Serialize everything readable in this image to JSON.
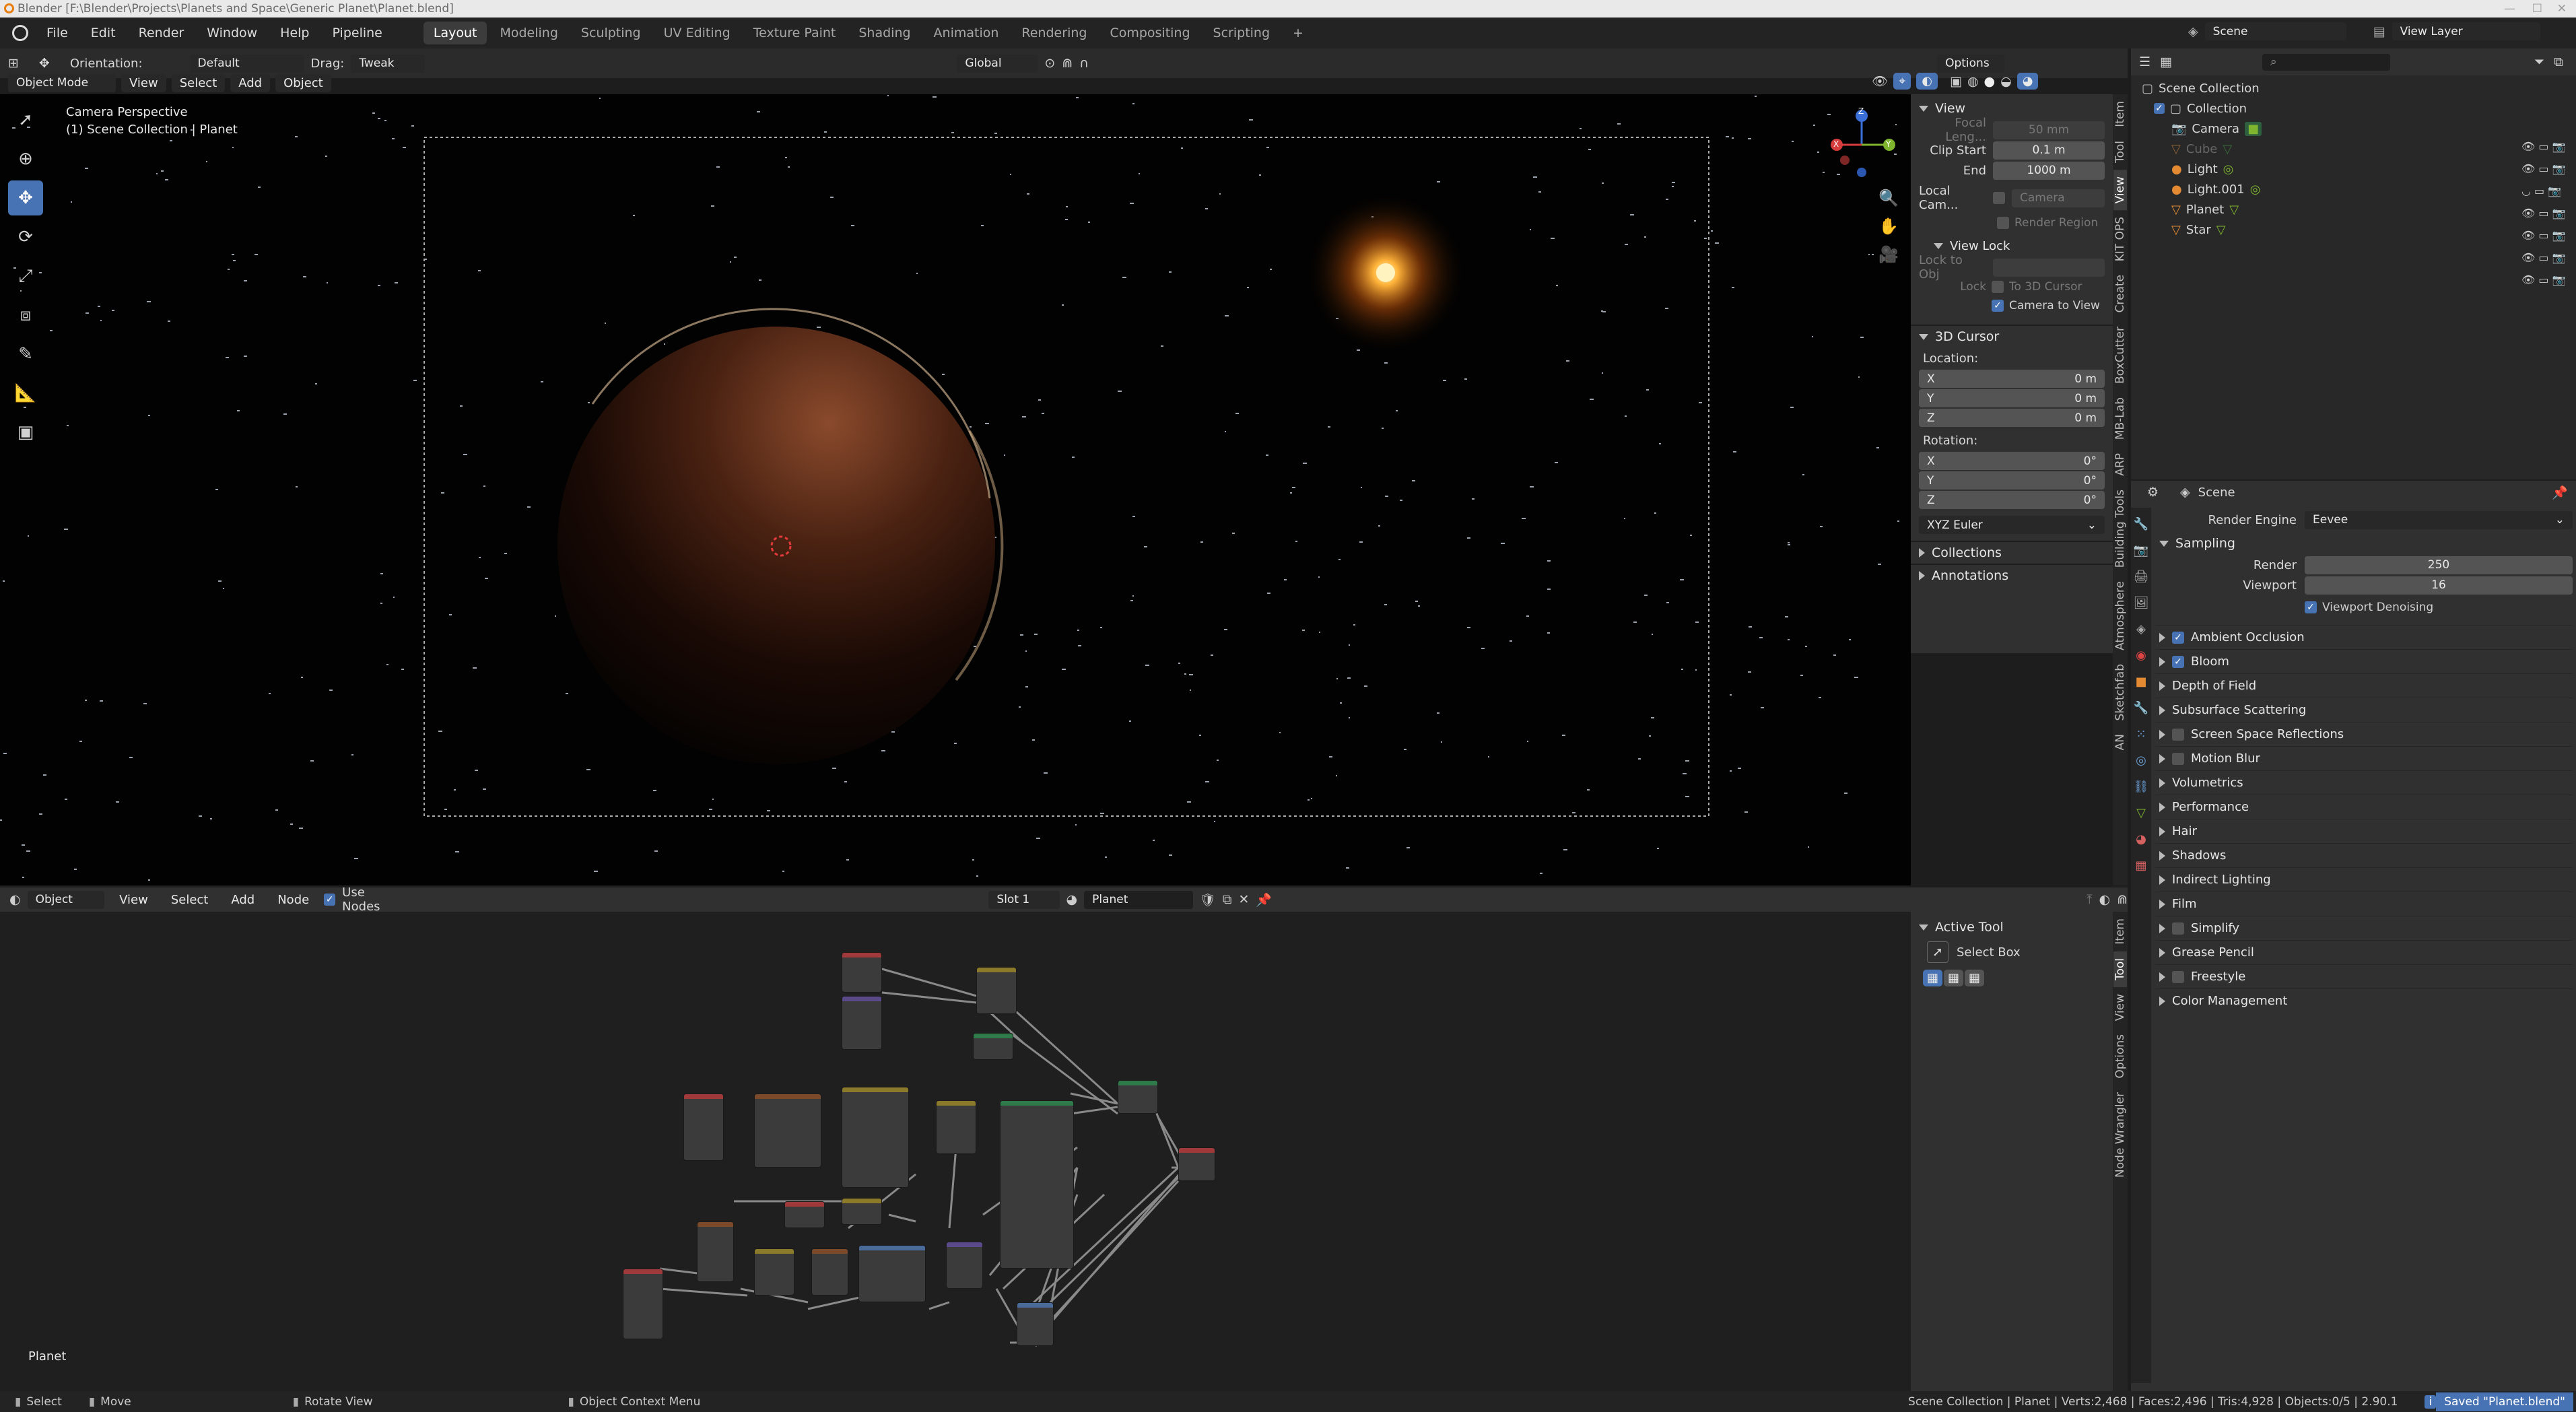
{
  "titlebar": {
    "text": "Blender [F:\\Blender\\Projects\\Planets and Space\\Generic Planet\\Planet.blend]"
  },
  "menus": [
    "File",
    "Edit",
    "Render",
    "Window",
    "Help",
    "Pipeline"
  ],
  "workspaces": [
    "Layout",
    "Modeling",
    "Sculpting",
    "UV Editing",
    "Texture Paint",
    "Shading",
    "Animation",
    "Rendering",
    "Compositing",
    "Scripting"
  ],
  "active_workspace": "Layout",
  "scene": {
    "label": "Scene",
    "view_layer": "View Layer"
  },
  "tool_settings": {
    "orientation_label": "Orientation:",
    "orientation_value": "Default",
    "drag_label": "Drag:",
    "drag_value": "Tweak",
    "transform_value": "Global",
    "options_label": "Options"
  },
  "viewport": {
    "mode": "Object Mode",
    "menus": [
      "View",
      "Select",
      "Add",
      "Object"
    ],
    "camera_label": "Camera Perspective",
    "collection_label": "(1) Scene Collection | Planet",
    "gizmo": {
      "x": "X",
      "y": "Y",
      "z": "Z"
    }
  },
  "npanel": {
    "view": {
      "title": "View",
      "focal_label": "Focal Leng...",
      "focal_value": "50 mm",
      "clip_start_label": "Clip Start",
      "clip_start_value": "0.1 m",
      "end_label": "End",
      "end_value": "1000 m",
      "local_cam_label": "Local Cam...",
      "local_cam_value": "Camera",
      "render_region": "Render Region",
      "view_lock": "View Lock",
      "lock_to_obj": "Lock to Obj",
      "lock_label": "Lock",
      "to_3d_cursor": "To 3D Cursor",
      "camera_to_view": "Camera to View"
    },
    "cursor": {
      "title": "3D Cursor",
      "location_label": "Location:",
      "loc": [
        {
          "axis": "X",
          "value": "0 m"
        },
        {
          "axis": "Y",
          "value": "0 m"
        },
        {
          "axis": "Z",
          "value": "0 m"
        }
      ],
      "rotation_label": "Rotation:",
      "rot": [
        {
          "axis": "X",
          "value": "0°"
        },
        {
          "axis": "Y",
          "value": "0°"
        },
        {
          "axis": "Z",
          "value": "0°"
        }
      ],
      "euler": "XYZ Euler"
    },
    "collections": "Collections",
    "annotations": "Annotations",
    "tabs": [
      "Item",
      "Tool",
      "View",
      "KIT OPS",
      "Create",
      "BoxCutter",
      "MB-Lab",
      "ARP",
      "Building Tools",
      "Atmosphere",
      "Sketchfab",
      "AN"
    ]
  },
  "outliner": {
    "root": "Scene Collection",
    "collection": "Collection",
    "items": [
      "Camera",
      "Cube",
      "Light",
      "Light.001",
      "Planet",
      "Star"
    ]
  },
  "properties": {
    "scene_label": "Scene",
    "render_engine_label": "Render Engine",
    "render_engine_value": "Eevee",
    "sampling": "Sampling",
    "render_label": "Render",
    "render_value": "250",
    "viewport_label": "Viewport",
    "viewport_value": "16",
    "viewport_denoising": "Viewport Denoising",
    "sections": [
      {
        "label": "Ambient Occlusion",
        "check": "on"
      },
      {
        "label": "Bloom",
        "check": "on"
      },
      {
        "label": "Depth of Field",
        "check": "none"
      },
      {
        "label": "Subsurface Scattering",
        "check": "none"
      },
      {
        "label": "Screen Space Reflections",
        "check": "off"
      },
      {
        "label": "Motion Blur",
        "check": "off"
      },
      {
        "label": "Volumetrics",
        "check": "none"
      },
      {
        "label": "Performance",
        "check": "none"
      },
      {
        "label": "Hair",
        "check": "none"
      },
      {
        "label": "Shadows",
        "check": "none"
      },
      {
        "label": "Indirect Lighting",
        "check": "none"
      },
      {
        "label": "Film",
        "check": "none"
      },
      {
        "label": "Simplify",
        "check": "off"
      },
      {
        "label": "Grease Pencil",
        "check": "none"
      },
      {
        "label": "Freestyle",
        "check": "off"
      },
      {
        "label": "Color Management",
        "check": "none"
      }
    ]
  },
  "node_editor": {
    "type": "Object",
    "menus": [
      "View",
      "Select",
      "Add",
      "Node"
    ],
    "use_nodes": "Use Nodes",
    "slot": "Slot 1",
    "material": "Planet",
    "active_tool_title": "Active Tool",
    "active_tool_value": "Select Box",
    "tabs": [
      "Item",
      "Tool",
      "View",
      "Options",
      "Node Wrangler"
    ],
    "material_label": "Planet"
  },
  "statusbar": {
    "select": "Select",
    "move": "Move",
    "rotate_view": "Rotate View",
    "context_menu": "Object Context Menu",
    "stats": "Scene Collection | Planet | Verts:2,468 | Faces:2,496 | Tris:4,928 | Objects:0/5 | 2.90.1",
    "saved": "Saved \"Planet.blend\""
  },
  "colors": {
    "accent": "#4772b3",
    "bg": "#1d1d1d",
    "panel": "#303030",
    "star": "#ffb43a",
    "planet": "#7a3c22"
  }
}
